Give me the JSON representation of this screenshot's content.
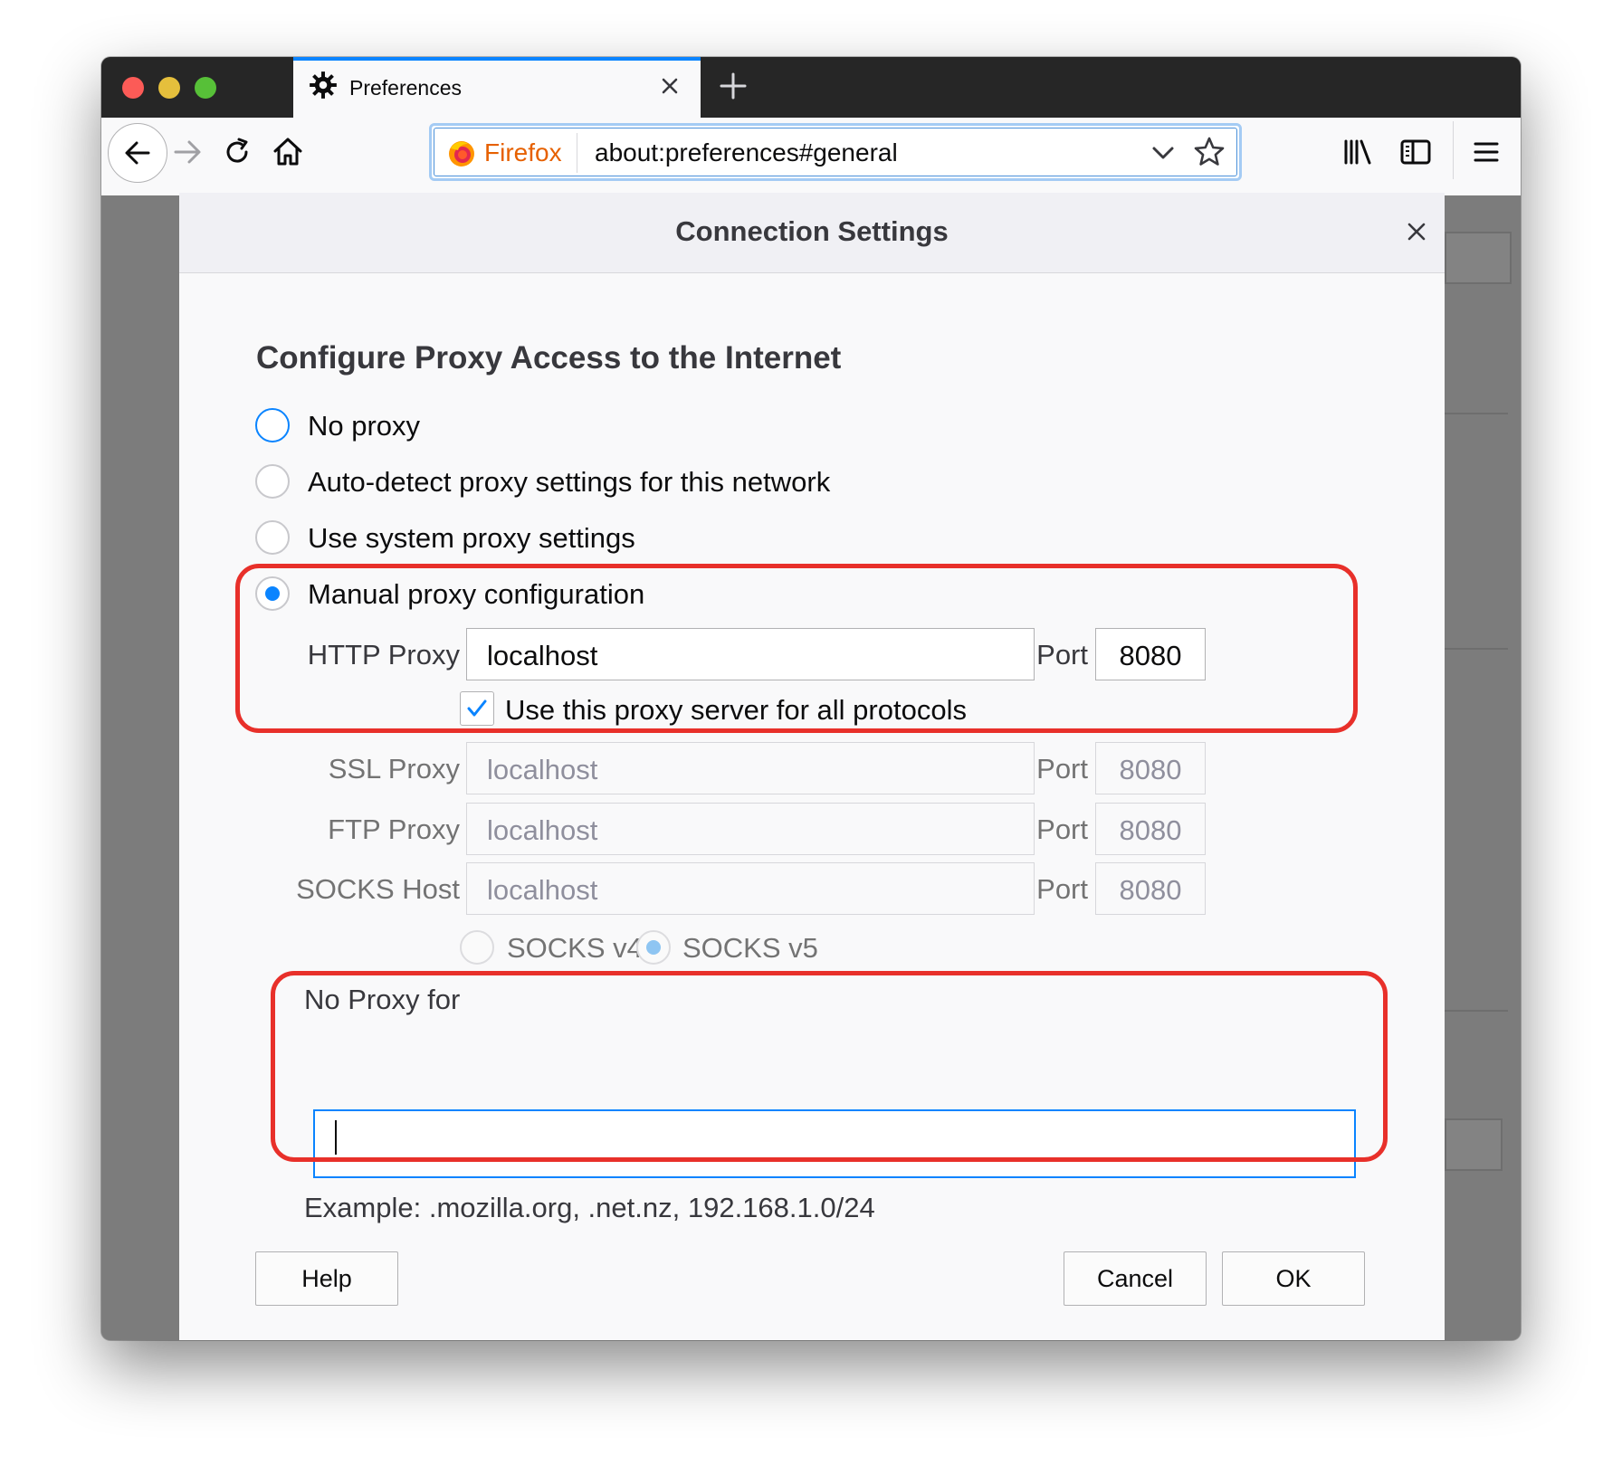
{
  "browser": {
    "tab_title": "Preferences",
    "url_brand": "Firefox",
    "url": "about:preferences#general"
  },
  "dialog": {
    "title": "Connection Settings",
    "heading": "Configure Proxy Access to the Internet",
    "options": {
      "no_proxy": "No proxy",
      "auto_detect": "Auto-detect proxy settings for this network",
      "system": "Use system proxy settings",
      "manual": "Manual proxy configuration"
    },
    "selected_option": "manual",
    "http": {
      "label": "HTTP Proxy",
      "host": "localhost",
      "port_label": "Port",
      "port": "8080"
    },
    "share_all": {
      "label": "Use this proxy server for all protocols",
      "checked": true
    },
    "ssl": {
      "label": "SSL Proxy",
      "host": "localhost",
      "port_label": "Port",
      "port": "8080"
    },
    "ftp": {
      "label": "FTP Proxy",
      "host": "localhost",
      "port_label": "Port",
      "port": "8080"
    },
    "socks": {
      "label": "SOCKS Host",
      "host": "localhost",
      "port_label": "Port",
      "port": "8080"
    },
    "socks_v4": "SOCKS v4",
    "socks_v5": "SOCKS v5",
    "socks_selected": "v5",
    "no_proxy_for": {
      "label": "No Proxy for",
      "value": "",
      "example": "Example: .mozilla.org, .net.nz, 192.168.1.0/24"
    },
    "buttons": {
      "help": "Help",
      "cancel": "Cancel",
      "ok": "OK"
    }
  },
  "colors": {
    "accent": "#0a84ff",
    "highlight": "#e8302a",
    "brand": "#e66000"
  }
}
